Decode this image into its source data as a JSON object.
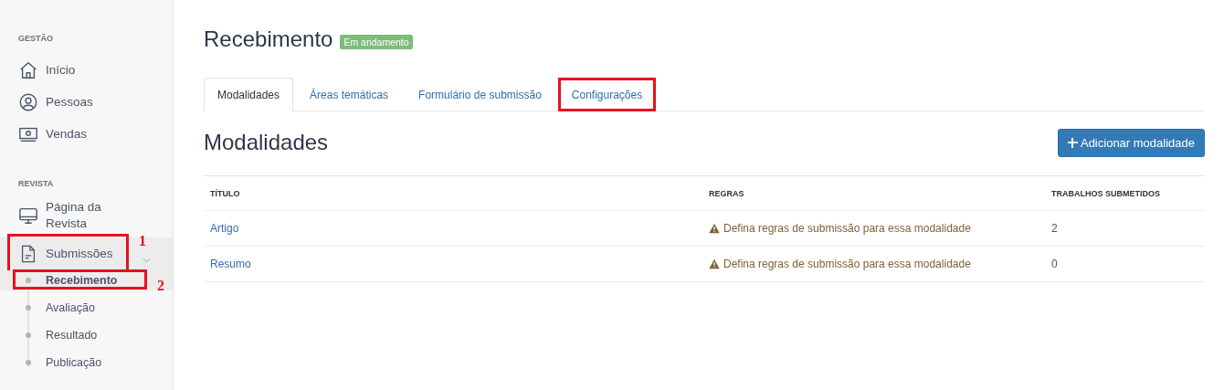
{
  "sidebar": {
    "sections": [
      {
        "heading": "GESTÃO",
        "items": [
          {
            "label": "Início",
            "selected": false,
            "annotated": false
          },
          {
            "label": "Pessoas",
            "selected": false,
            "annotated": false
          },
          {
            "label": "Vendas",
            "selected": false,
            "annotated": false
          }
        ]
      },
      {
        "heading": "REVISTA",
        "items": [
          {
            "label": "Página da Revista",
            "selected": false,
            "annotated": false
          },
          {
            "label": "Submissões",
            "selected": true,
            "expanded": true,
            "annotated": true,
            "annotation_label": "1",
            "children": [
              {
                "label": "Recebimento",
                "selected": true,
                "annotated": true,
                "annotation_label": "2"
              },
              {
                "label": "Avaliação",
                "selected": false,
                "annotated": false
              },
              {
                "label": "Resultado",
                "selected": false,
                "annotated": false
              },
              {
                "label": "Publicação",
                "selected": false,
                "annotated": false
              }
            ]
          }
        ]
      }
    ]
  },
  "page": {
    "title": "Recebimento",
    "status_badge": "Em andamento"
  },
  "tabs": [
    {
      "label": "Modalidades",
      "selected": true,
      "annotated": false
    },
    {
      "label": "Áreas temáticas",
      "selected": false,
      "annotated": false
    },
    {
      "label": "Formulário de submissão",
      "selected": false,
      "annotated": false
    },
    {
      "label": "Configurações",
      "selected": false,
      "annotated": true
    }
  ],
  "section": {
    "heading": "Modalidades",
    "add_button": "Adicionar modalidade"
  },
  "table": {
    "columns": [
      "TÍTULO",
      "REGRAS",
      "TRABALHOS SUBMETIDOS"
    ],
    "rows": [
      {
        "title": "Artigo",
        "rules": "Defina regras de submissão para essa modalidade",
        "warning": true,
        "count": "2"
      },
      {
        "title": "Resumo",
        "rules": "Defina regras de submissão para essa modalidade",
        "warning": true,
        "count": "0"
      }
    ]
  }
}
